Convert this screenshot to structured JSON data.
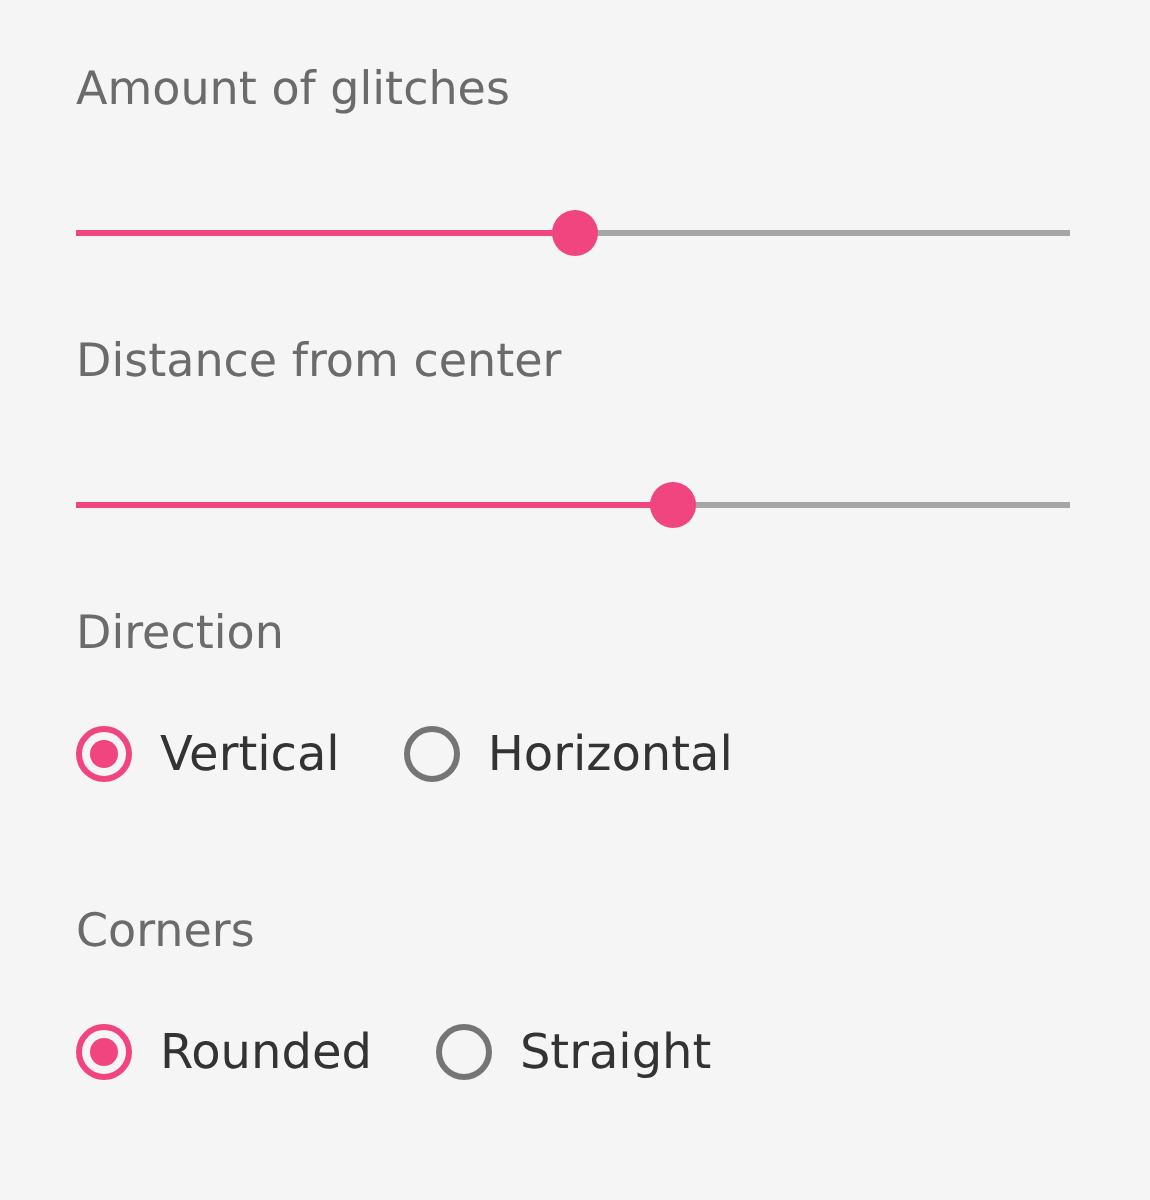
{
  "sliders": [
    {
      "label": "Amount of glitches",
      "level": 0.5
    },
    {
      "label": "Distance from center",
      "level": 0.6
    }
  ],
  "radio_groups": [
    {
      "label": "Direction",
      "options": [
        {
          "label": "Vertical",
          "selected": true
        },
        {
          "label": "Horizontal",
          "selected": false
        }
      ]
    },
    {
      "label": "Corners",
      "options": [
        {
          "label": "Rounded",
          "selected": true
        },
        {
          "label": "Straight",
          "selected": false
        }
      ]
    }
  ]
}
